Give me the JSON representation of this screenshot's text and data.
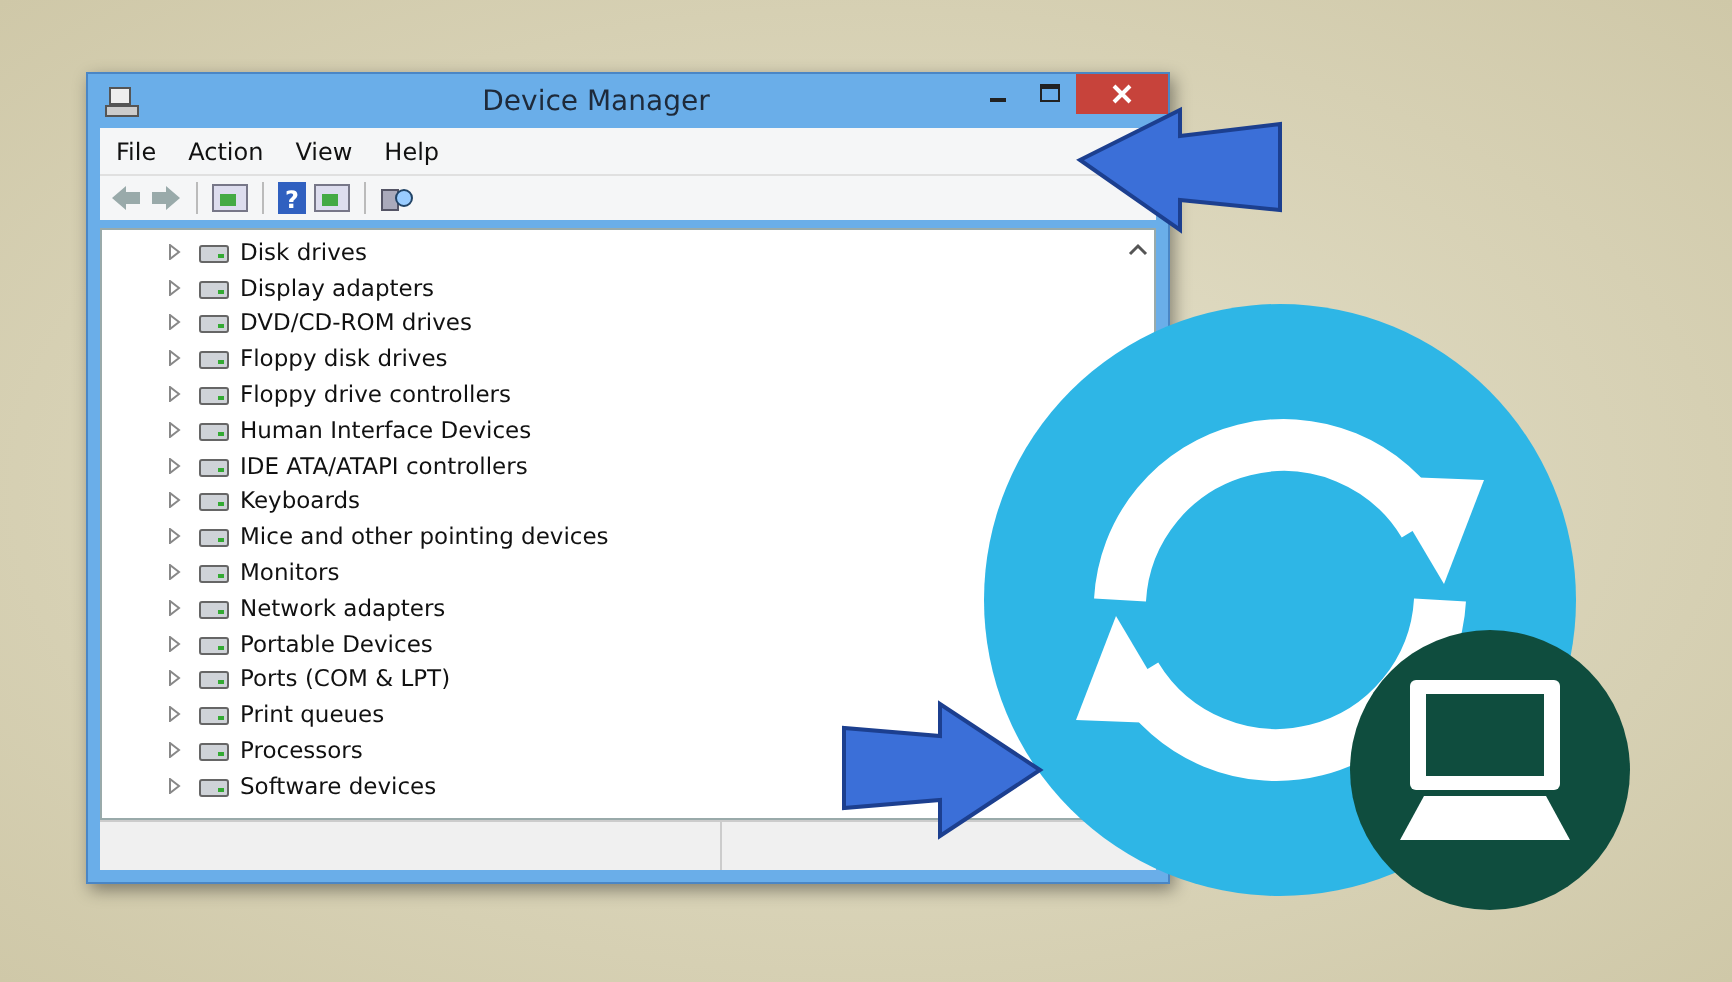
{
  "window": {
    "title": "Device Manager"
  },
  "menu": [
    "File",
    "Action",
    "View",
    "Help"
  ],
  "toolbar": {
    "help_glyph": "?"
  },
  "tree": {
    "items": [
      {
        "label": "Disk drives",
        "expanded": false
      },
      {
        "label": "Display adapters",
        "expanded": false
      },
      {
        "label": "DVD/CD-ROM drives",
        "expanded": false
      },
      {
        "label": "Floppy disk drives",
        "expanded": false
      },
      {
        "label": "Floppy drive controllers",
        "expanded": false
      },
      {
        "label": "Human Interface Devices",
        "expanded": false
      },
      {
        "label": "IDE ATA/ATAPI controllers",
        "expanded": false
      },
      {
        "label": "Keyboards",
        "expanded": false
      },
      {
        "label": "Mice and other pointing devices",
        "expanded": false
      },
      {
        "label": "Monitors",
        "expanded": false
      },
      {
        "label": "Network adapters",
        "expanded": false
      },
      {
        "label": "Portable Devices",
        "expanded": false
      },
      {
        "label": "Ports (COM & LPT)",
        "expanded": false
      },
      {
        "label": "Print queues",
        "expanded": false
      },
      {
        "label": "Processors",
        "expanded": false
      },
      {
        "label": "Software devices",
        "expanded": false
      }
    ]
  }
}
